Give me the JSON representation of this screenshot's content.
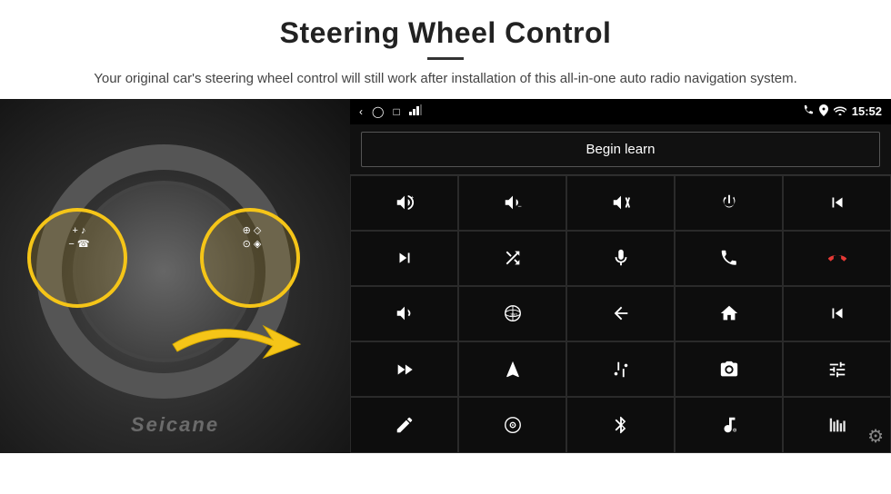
{
  "header": {
    "title": "Steering Wheel Control",
    "subtitle": "Your original car's steering wheel control will still work after installation of this all-in-one auto radio navigation system."
  },
  "status_bar": {
    "time": "15:52",
    "icons": [
      "back-arrow",
      "home-circle",
      "square-icon",
      "signal-icon",
      "phone-icon",
      "location-icon",
      "wifi-icon"
    ]
  },
  "begin_learn": {
    "label": "Begin learn"
  },
  "controls": [
    {
      "icon": "vol-up",
      "symbol": "🔊+"
    },
    {
      "icon": "vol-down",
      "symbol": "🔉−"
    },
    {
      "icon": "mute",
      "symbol": "🔇"
    },
    {
      "icon": "power",
      "symbol": "⏻"
    },
    {
      "icon": "prev-track",
      "symbol": "⏮"
    },
    {
      "icon": "skip-forward",
      "symbol": "⏭"
    },
    {
      "icon": "shuffle",
      "symbol": "⇄"
    },
    {
      "icon": "mic",
      "symbol": "🎙"
    },
    {
      "icon": "phone",
      "symbol": "📞"
    },
    {
      "icon": "hang-up",
      "symbol": "📵"
    },
    {
      "icon": "horn",
      "symbol": "📣"
    },
    {
      "icon": "view-360",
      "symbol": "👁"
    },
    {
      "icon": "back",
      "symbol": "↩"
    },
    {
      "icon": "home",
      "symbol": "🏠"
    },
    {
      "icon": "skip-back",
      "symbol": "⏮"
    },
    {
      "icon": "fast-forward",
      "symbol": "⏭"
    },
    {
      "icon": "navigation",
      "symbol": "➤"
    },
    {
      "icon": "equalizer",
      "symbol": "⇌"
    },
    {
      "icon": "camera",
      "symbol": "📷"
    },
    {
      "icon": "settings-eq",
      "symbol": "⚙"
    },
    {
      "icon": "pen",
      "symbol": "✏"
    },
    {
      "icon": "disc",
      "symbol": "⊙"
    },
    {
      "icon": "bluetooth",
      "symbol": "⚡"
    },
    {
      "icon": "music",
      "symbol": "♪"
    },
    {
      "icon": "equalizer2",
      "symbol": "▮▮▮"
    }
  ],
  "watermark": "Seicane",
  "settings_icon": "⚙"
}
